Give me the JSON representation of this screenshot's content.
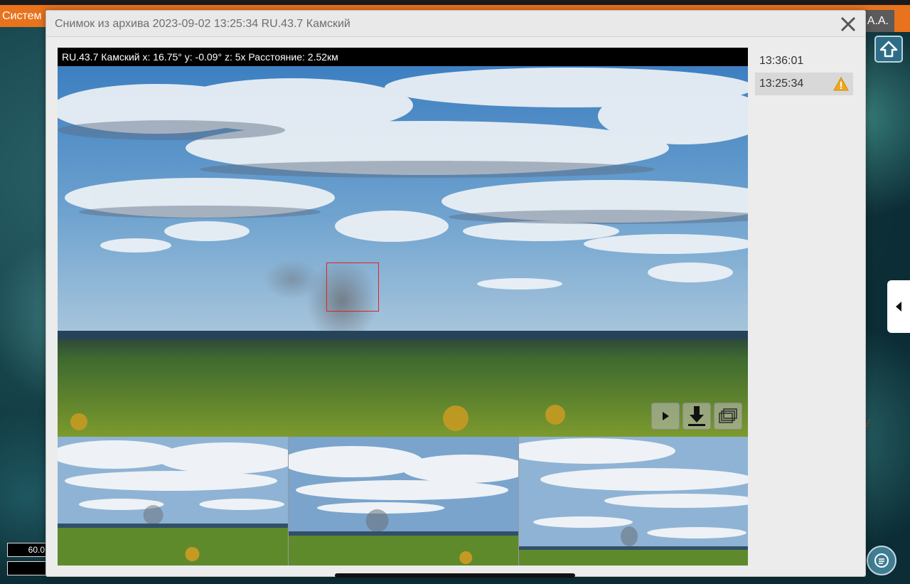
{
  "app": {
    "title": "Систем",
    "user_name": "А.А.",
    "accent_color": "#e8731c"
  },
  "map": {
    "scale_value": "60.0",
    "home_icon": "home-icon",
    "panel_toggle_icon": "chevron-left-icon",
    "chat_icon": "chat-icon"
  },
  "modal": {
    "title": "Снимок из архива 2023-09-02 13:25:34 RU.43.7 Камский",
    "close_icon": "close-icon",
    "camera_info": "RU.43.7 Камский x: 16.75° y: -0.09° z: 5x Расстояние: 2.52км",
    "controls": {
      "play_icon": "play-icon",
      "download_icon": "download-icon",
      "gallery_icon": "gallery-icon"
    },
    "timestamps": [
      {
        "time": "13:36:01",
        "selected": false,
        "alert": false
      },
      {
        "time": "13:25:34",
        "selected": true,
        "alert": true
      }
    ],
    "thumbnail_count_shown": 3
  }
}
